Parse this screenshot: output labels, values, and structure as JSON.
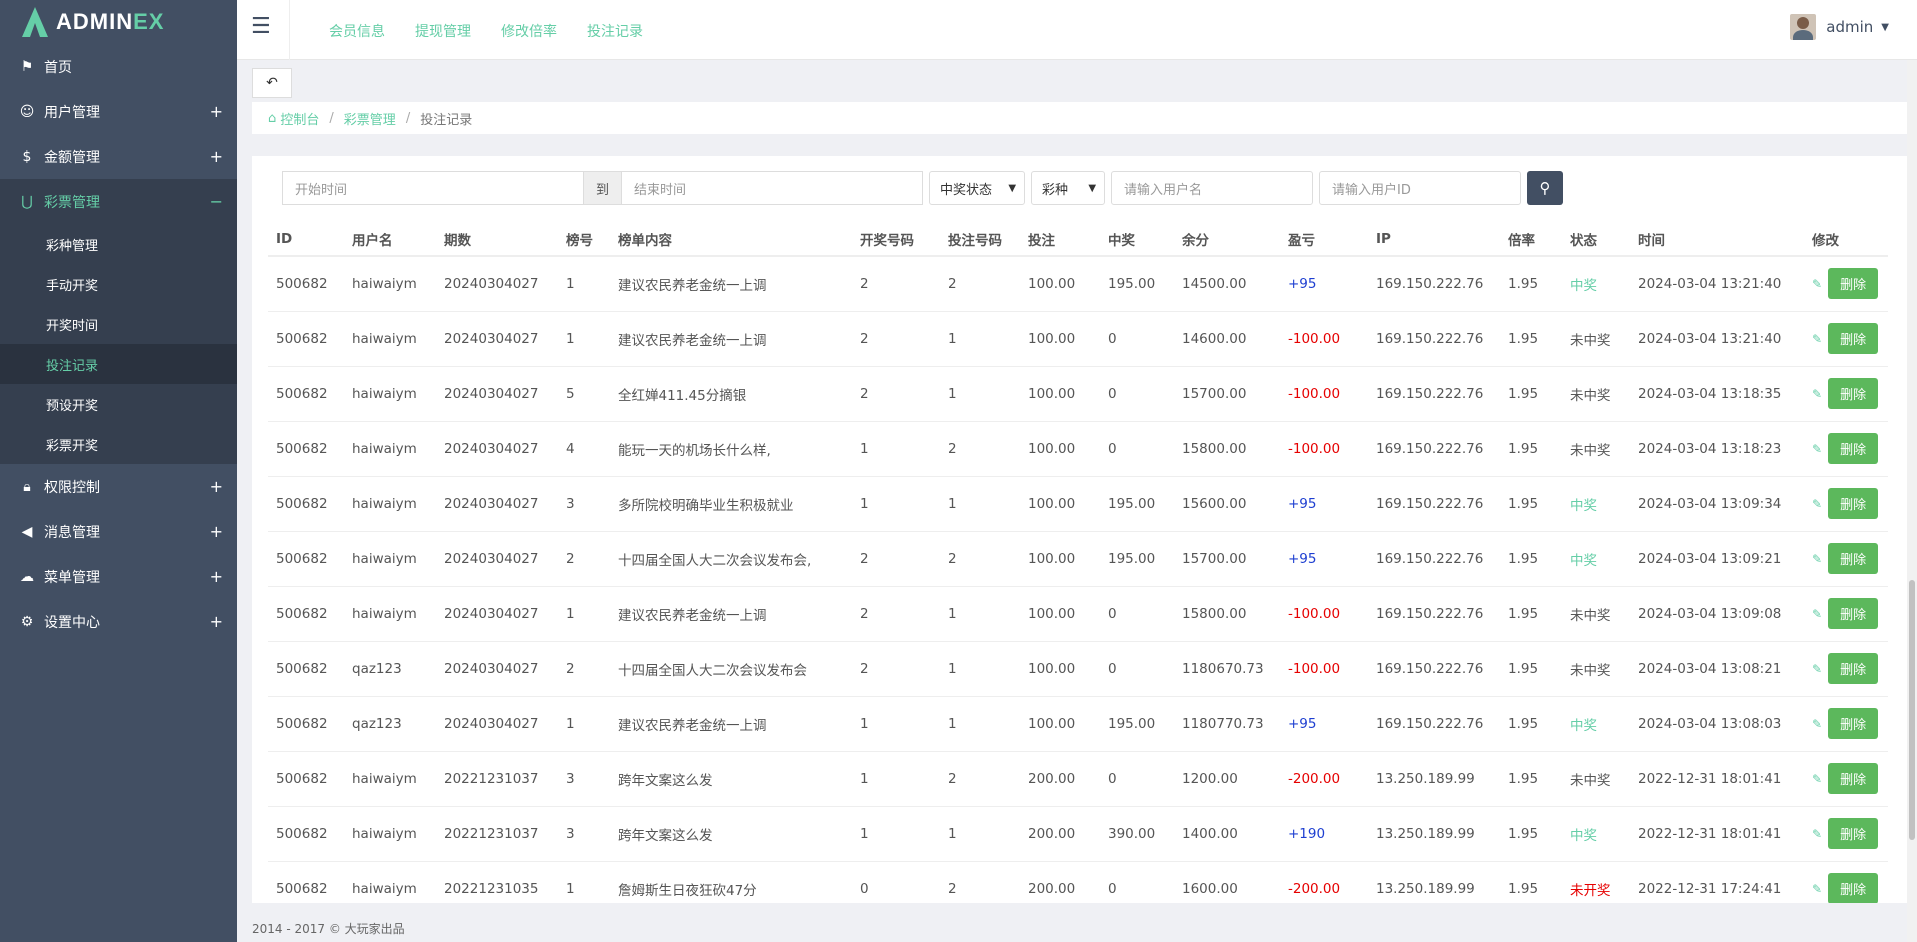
{
  "brand": {
    "name_main": "ADMIN",
    "name_accent": "EX"
  },
  "sidebar": {
    "items": [
      {
        "label": "首页",
        "icon": "flag-icon",
        "toggle": ""
      },
      {
        "label": "用户管理",
        "icon": "users-icon",
        "toggle": "+"
      },
      {
        "label": "金额管理",
        "icon": "dollar-icon",
        "toggle": "+"
      },
      {
        "label": "彩票管理",
        "icon": "magnet-icon",
        "toggle": "−"
      },
      {
        "label": "权限控制",
        "icon": "lock-icon",
        "toggle": "+"
      },
      {
        "label": "消息管理",
        "icon": "bullhorn-icon",
        "toggle": "+"
      },
      {
        "label": "菜单管理",
        "icon": "cloud-icon",
        "toggle": "+"
      },
      {
        "label": "设置中心",
        "icon": "gear-icon",
        "toggle": "+"
      }
    ],
    "submenu": [
      "彩种管理",
      "手动开奖",
      "开奖时间",
      "投注记录",
      "预设开奖",
      "彩票开奖"
    ]
  },
  "topnav": [
    "会员信息",
    "提现管理",
    "修改倍率",
    "投注记录"
  ],
  "user": {
    "name": "admin"
  },
  "breadcrumb": {
    "home": "控制台",
    "parent": "彩票管理",
    "current": "投注记录"
  },
  "filters": {
    "start_placeholder": "开始时间",
    "to_label": "到",
    "end_placeholder": "结束时间",
    "status_select": "中奖状态",
    "type_select": "彩种",
    "username_placeholder": "请输入用户名",
    "userid_placeholder": "请输入用户ID"
  },
  "table": {
    "headers": [
      "ID",
      "用户名",
      "期数",
      "榜号",
      "榜单内容",
      "开奖号码",
      "投注号码",
      "投注",
      "中奖",
      "余分",
      "盈亏",
      "IP",
      "倍率",
      "状态",
      "时间",
      "修改"
    ],
    "rows": [
      [
        "500682",
        "haiwaiym",
        "20240304027",
        "1",
        "建议农民养老金统一上调",
        "2",
        "2",
        "100.00",
        "195.00",
        "14500.00",
        "+95",
        "169.150.222.76",
        "1.95",
        "中奖",
        "2024-03-04 13:21:40"
      ],
      [
        "500682",
        "haiwaiym",
        "20240304027",
        "1",
        "建议农民养老金统一上调",
        "2",
        "1",
        "100.00",
        "0",
        "14600.00",
        "-100.00",
        "169.150.222.76",
        "1.95",
        "未中奖",
        "2024-03-04 13:21:40"
      ],
      [
        "500682",
        "haiwaiym",
        "20240304027",
        "5",
        "全红婵411.45分摘银",
        "2",
        "1",
        "100.00",
        "0",
        "15700.00",
        "-100.00",
        "169.150.222.76",
        "1.95",
        "未中奖",
        "2024-03-04 13:18:35"
      ],
      [
        "500682",
        "haiwaiym",
        "20240304027",
        "4",
        "能玩一天的机场长什么样,",
        "1",
        "2",
        "100.00",
        "0",
        "15800.00",
        "-100.00",
        "169.150.222.76",
        "1.95",
        "未中奖",
        "2024-03-04 13:18:23"
      ],
      [
        "500682",
        "haiwaiym",
        "20240304027",
        "3",
        "多所院校明确毕业生积极就业",
        "1",
        "1",
        "100.00",
        "195.00",
        "15600.00",
        "+95",
        "169.150.222.76",
        "1.95",
        "中奖",
        "2024-03-04 13:09:34"
      ],
      [
        "500682",
        "haiwaiym",
        "20240304027",
        "2",
        "十四届全国人大二次会议发布会,",
        "2",
        "2",
        "100.00",
        "195.00",
        "15700.00",
        "+95",
        "169.150.222.76",
        "1.95",
        "中奖",
        "2024-03-04 13:09:21"
      ],
      [
        "500682",
        "haiwaiym",
        "20240304027",
        "1",
        "建议农民养老金统一上调",
        "2",
        "1",
        "100.00",
        "0",
        "15800.00",
        "-100.00",
        "169.150.222.76",
        "1.95",
        "未中奖",
        "2024-03-04 13:09:08"
      ],
      [
        "500682",
        "qaz123",
        "20240304027",
        "2",
        "十四届全国人大二次会议发布会",
        "2",
        "1",
        "100.00",
        "0",
        "1180670.73",
        "-100.00",
        "169.150.222.76",
        "1.95",
        "未中奖",
        "2024-03-04 13:08:21"
      ],
      [
        "500682",
        "qaz123",
        "20240304027",
        "1",
        "建议农民养老金统一上调",
        "1",
        "1",
        "100.00",
        "195.00",
        "1180770.73",
        "+95",
        "169.150.222.76",
        "1.95",
        "中奖",
        "2024-03-04 13:08:03"
      ],
      [
        "500682",
        "haiwaiym",
        "20221231037",
        "3",
        "跨年文案这么发",
        "1",
        "2",
        "200.00",
        "0",
        "1200.00",
        "-200.00",
        "13.250.189.99",
        "1.95",
        "未中奖",
        "2022-12-31 18:01:41"
      ],
      [
        "500682",
        "haiwaiym",
        "20221231037",
        "3",
        "跨年文案这么发",
        "1",
        "1",
        "200.00",
        "390.00",
        "1400.00",
        "+190",
        "13.250.189.99",
        "1.95",
        "中奖",
        "2022-12-31 18:01:41"
      ],
      [
        "500682",
        "haiwaiym",
        "20221231035",
        "1",
        "詹姆斯生日夜狂砍47分",
        "0",
        "2",
        "200.00",
        "0",
        "1600.00",
        "-200.00",
        "13.250.189.99",
        "1.95",
        "未开奖",
        "2022-12-31 17:24:41"
      ]
    ],
    "delete_label": "删除"
  },
  "footer": "2014 - 2017 © 大玩家出品",
  "colors": {
    "sidebar": "#424f63",
    "accent": "#65cea7",
    "positive": "#1e3fd1",
    "negative": "#e60000",
    "delete": "#5cb85c"
  }
}
